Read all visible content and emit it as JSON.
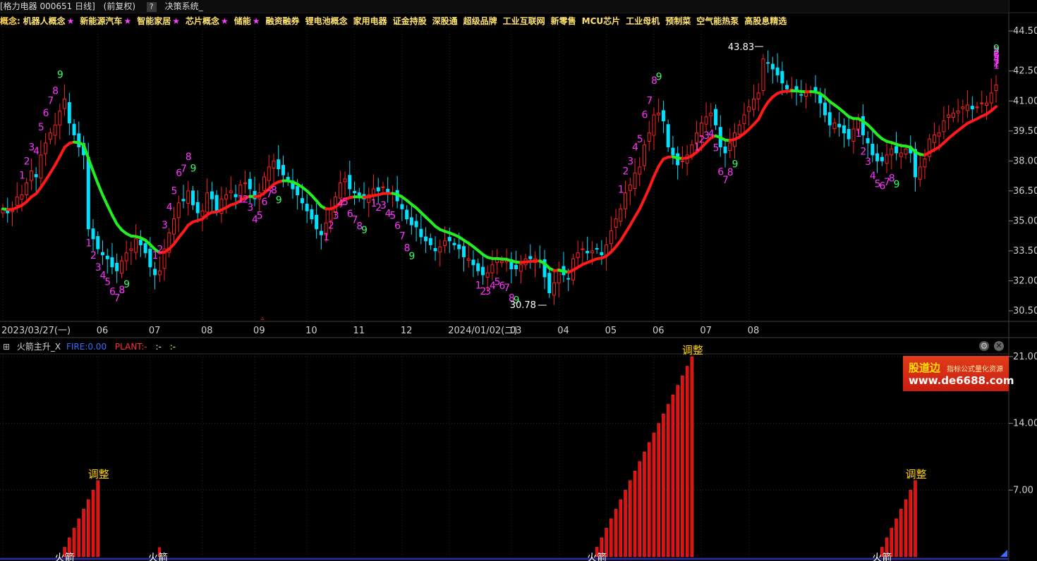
{
  "title_bar": {
    "stock": "[格力电器 000651 日线]",
    "adjust": "(前复权)",
    "help": "?",
    "system": "决策系统_"
  },
  "concepts": {
    "label": "概念:",
    "items": [
      {
        "name": "机器人概念",
        "star": true
      },
      {
        "name": "新能源汽车",
        "star": true
      },
      {
        "name": "智能家居",
        "star": true
      },
      {
        "name": "芯片概念",
        "star": true
      },
      {
        "name": "储能",
        "star": true
      },
      {
        "name": "融资融券",
        "star": false
      },
      {
        "name": "锂电池概念",
        "star": false
      },
      {
        "name": "家用电器",
        "star": false
      },
      {
        "name": "证金持股",
        "star": false
      },
      {
        "name": "深股通",
        "star": false
      },
      {
        "name": "超级品牌",
        "star": false
      },
      {
        "name": "工业互联网",
        "star": false
      },
      {
        "name": "新零售",
        "star": false
      },
      {
        "name": "MCU芯片",
        "star": false
      },
      {
        "name": "工业母机",
        "star": false
      },
      {
        "name": "预制菜",
        "star": false
      },
      {
        "name": "空气能热泵",
        "star": false
      },
      {
        "name": "高股息精选",
        "star": false
      }
    ],
    "star_symbol": "★"
  },
  "price_axis": [
    "44.50",
    "42.50",
    "41.00",
    "39.50",
    "38.00",
    "36.50",
    "35.00",
    "33.50",
    "32.00",
    "30.50"
  ],
  "date_axis": [
    "2023/03/27(一)",
    "06",
    "07",
    "08",
    "09",
    "10",
    "11",
    "12",
    "2024/01/02(二)",
    "03",
    "04",
    "05",
    "06",
    "07",
    "08"
  ],
  "annotations": {
    "high": "43.83",
    "low": "30.78"
  },
  "indicator": {
    "expand": "⊞",
    "name": "火箭主升_X",
    "fire": "FIRE:0.00",
    "plant": "PLANT:-",
    "k1": ":-",
    "k2": ":-",
    "axis": [
      "21.00",
      "14.00",
      "7.00"
    ],
    "label": "调整",
    "bottom_label": "火箭"
  },
  "watermark": {
    "brand": "股道边",
    "tagline": "指标公式量化资源",
    "url": "www.de6688.com"
  },
  "colors": {
    "up": "#ff2020",
    "down": "#00e0ff",
    "ma_up": "#ff1a1a",
    "ma_down": "#22ee22",
    "count": "#ff33ff",
    "count9": "#33ff66",
    "label": "#ffd000"
  },
  "chart_data": {
    "type": "candlestick",
    "series": [
      {
        "values": [
          35.6,
          35.4,
          35.6,
          36.2,
          36.3,
          36.9,
          37.5,
          37.2,
          38.3,
          38.9,
          39.4,
          39.8,
          40.5,
          41.1,
          39.9,
          39.3,
          38.7,
          38.3,
          34.6,
          34.1,
          33.6,
          33.3,
          33.1,
          32.7,
          32.5,
          33.0,
          33.4,
          33.6,
          34.1,
          33.8,
          33.4,
          32.7,
          32.3,
          32.5,
          33.6,
          34.4,
          35.1,
          35.9,
          36.0,
          36.5,
          35.8,
          35.4,
          35.5,
          36.4,
          36.1,
          35.5,
          36.1,
          36.3,
          36.5,
          36.2,
          36.8,
          36.9,
          36.6,
          36.1,
          36.4,
          37.2,
          37.7,
          38.0,
          37.6,
          37.3,
          37.0,
          36.6,
          36.3,
          35.9,
          35.5,
          35.1,
          34.6,
          34.3,
          34.9,
          35.6,
          36.2,
          36.9,
          37.1,
          36.6,
          36.4,
          36.2,
          36.1,
          36.3,
          36.6,
          36.5,
          36.7,
          36.4,
          36.4,
          36.0,
          35.6,
          35.1,
          34.8,
          34.7,
          34.2,
          34.0,
          33.8,
          33.5,
          33.7,
          34.0,
          34.0,
          33.8,
          33.6,
          33.2,
          33.1,
          32.8,
          32.5,
          32.3,
          32.4,
          32.8,
          33.1,
          33.0,
          33.0,
          32.6,
          32.6,
          32.8,
          33.1,
          33.1,
          33.1,
          33.0,
          32.2,
          31.4,
          31.9,
          32.6,
          32.3,
          32.1,
          33.1,
          33.4,
          33.6,
          33.4,
          33.5,
          33.6,
          33.3,
          33.8,
          34.5,
          35.1,
          35.6,
          36.4,
          36.8,
          37.4,
          37.7,
          38.8,
          39.4,
          40.3,
          40.4,
          40.0,
          38.7,
          38.3,
          37.8,
          38.0,
          38.3,
          38.8,
          39.4,
          39.9,
          40.2,
          40.4,
          39.8,
          38.7,
          38.4,
          38.9,
          39.4,
          39.8,
          40.3,
          40.7,
          41.1,
          41.4,
          43.1,
          42.9,
          42.6,
          42.3,
          41.9,
          41.6,
          41.6,
          41.5,
          41.3,
          41.4,
          41.5,
          41.4,
          40.9,
          40.3,
          39.8,
          39.9,
          39.7,
          39.4,
          39.1,
          39.6,
          40.1,
          39.3,
          38.9,
          38.3,
          38.0,
          38.0,
          38.3,
          38.6,
          38.4,
          38.4,
          38.6,
          38.4,
          37.2,
          37.7,
          38.1,
          39.1,
          39.3,
          39.4,
          40.0,
          40.3,
          40.4,
          40.5,
          40.7,
          40.8,
          40.6,
          40.7,
          40.9,
          40.9,
          41.4,
          41.8
        ]
      }
    ]
  }
}
